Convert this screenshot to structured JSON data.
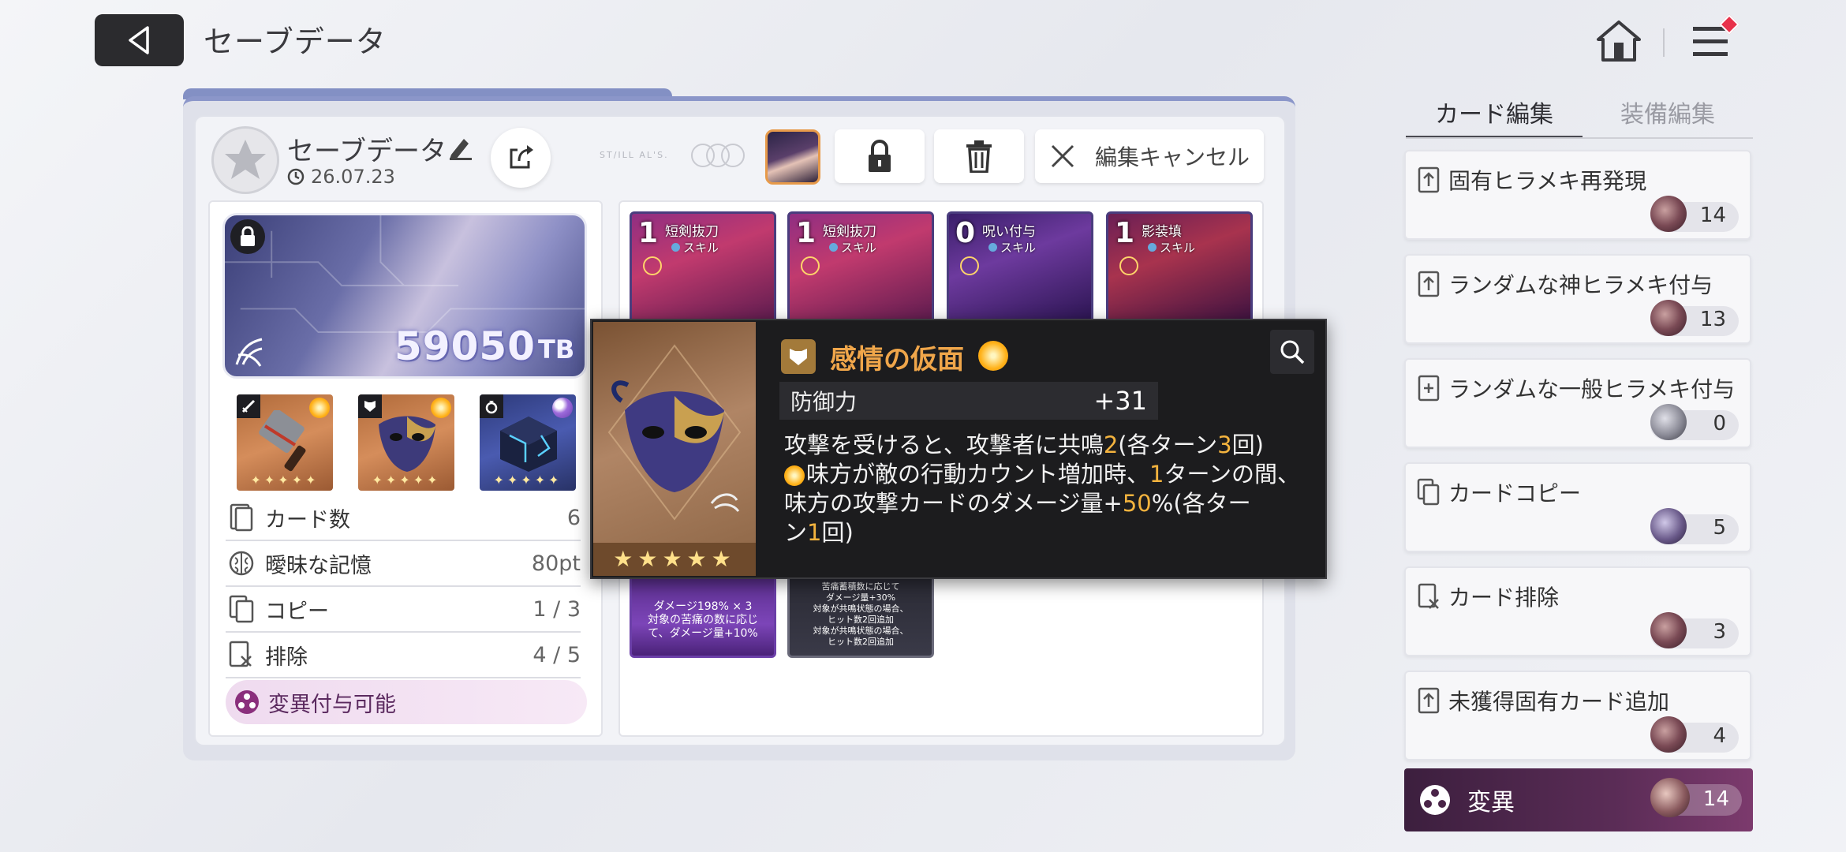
{
  "header": {
    "title": "セーブデータ"
  },
  "save": {
    "name": "セーブデータ",
    "date": "26.07.23",
    "edit_cancel": "編集キャンセル",
    "deco_text": "ST/ILL AL'S."
  },
  "banner": {
    "value": "59050",
    "unit": "TB"
  },
  "equipment": [
    {
      "type": "weapon",
      "rarity_color": "#ffb21a",
      "stars": "✦✦✦✦✦"
    },
    {
      "type": "armor",
      "rarity_color": "#ffb21a",
      "stars": "✦✦✦✦✦"
    },
    {
      "type": "accessory",
      "rarity_color": "#9d6bdb",
      "stars": "✦✦✦✦✦"
    }
  ],
  "stats": [
    {
      "label": "カード数",
      "value": "6"
    },
    {
      "label": "曖昧な記憶",
      "value": "80pt"
    },
    {
      "label": "コピー",
      "value": "1 / 3"
    },
    {
      "label": "排除",
      "value": "4 / 5"
    }
  ],
  "mutation_available": "変異付与可能",
  "cards": [
    {
      "cost": "1",
      "name": "短剣抜刀",
      "type": "スキル"
    },
    {
      "cost": "1",
      "name": "短剣抜刀",
      "type": "スキル"
    },
    {
      "cost": "0",
      "name": "呪い付与",
      "type": "スキル"
    },
    {
      "cost": "1",
      "name": "影装填",
      "type": "スキル"
    }
  ],
  "lower_cards": [
    {
      "text_1": "ダメージ198% × 3",
      "text_2": "対象の苦痛の数に応じ",
      "text_3": "て、ダメージ量+10%"
    },
    {
      "text_1": "苦痛蓄積数に応じて",
      "text_2": "ダメージ量+30%",
      "text_3": "対象が共鳴状態の場合、",
      "text_4": "ヒット数2回追加",
      "text_5": "対象が共鳴状態の場合、",
      "text_6": "ヒット数2回追加"
    }
  ],
  "tooltip": {
    "title": "感情の仮面",
    "stat_label": "防御力",
    "stat_value": "+31",
    "desc_1a": "攻撃を受けると、攻撃者に共鳴",
    "desc_1b": "2",
    "desc_1c": "(各ターン",
    "desc_1d": "3",
    "desc_1e": "回)",
    "desc_2a": "味方が敵の行動カウント増加時、",
    "desc_2b": "1",
    "desc_2c": "ターンの間、",
    "desc_3a": "味方の攻撃カードのダメージ量+",
    "desc_3b": "50",
    "desc_3c": "%(各ター",
    "desc_4a": "ン",
    "desc_4b": "1",
    "desc_4c": "回)",
    "stars": "★★★★★",
    "accent_color": "#f0a64a"
  },
  "sidebar": {
    "tabs": [
      "カード編集",
      "装備編集"
    ],
    "items": [
      {
        "label": "固有ヒラメキ再発現",
        "count": "14"
      },
      {
        "label": "ランダムな神ヒラメキ付与",
        "count": "13"
      },
      {
        "label": "ランダムな一般ヒラメキ付与",
        "count": "0"
      },
      {
        "label": "カードコピー",
        "count": "5"
      },
      {
        "label": "カード排除",
        "count": "3"
      },
      {
        "label": "未獲得固有カード追加",
        "count": "4"
      }
    ],
    "mutation": {
      "label": "変異",
      "count": "14"
    }
  }
}
